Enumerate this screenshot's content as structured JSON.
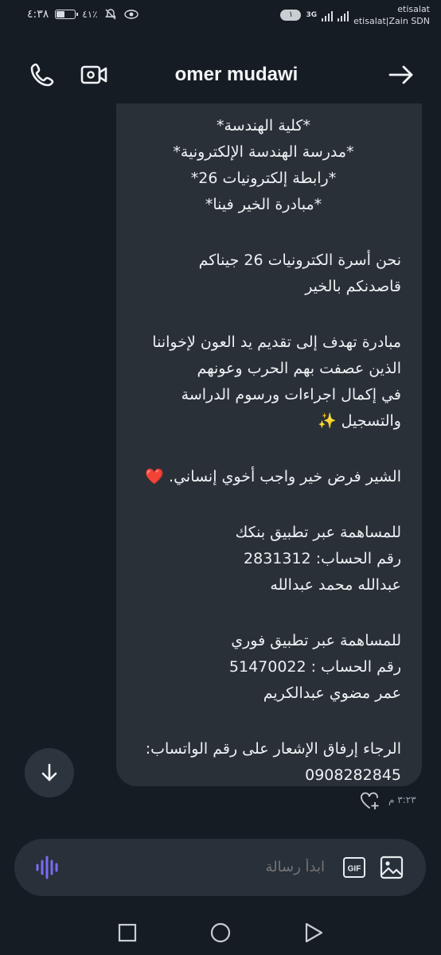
{
  "status": {
    "time": "٤:٣٨",
    "battery_pct": "٤١٪",
    "sim_slot": "١",
    "network_type": "3G",
    "carrier_1": "etisalat",
    "carrier_2": "etisalat|Zain SDN"
  },
  "header": {
    "contact_name": "omer mudawi",
    "icons": [
      "phone-icon",
      "video-call-icon",
      "arrow-right-icon"
    ]
  },
  "message": {
    "lines": [
      "*كلية الهندسة*",
      "*مدرسة الهندسة الإلكترونية*",
      "*رابطة إلكترونيات 26*",
      "*مبادرة الخير فينا*",
      "نحن أسرة الكترونيات 26 جيناكم",
      "قاصدنكم بالخير",
      "مبادرة تهدف إلى تقديم يد العون لإخواننا",
      "الذين عصفت بهم الحرب وعونهم",
      "في إكمال اجراءات ورسوم الدراسة",
      "والتسجيل",
      "الشير فرض خير واجب أخوي إنساني.",
      "للمساهمة عبر تطبيق بنكك",
      "رقم الحساب: 2831312",
      "عبدالله محمد عبدالله",
      "للمساهمة عبر تطبيق فوري",
      "رقم الحساب : 51470022",
      "عمر مضوي عبدالكريم",
      "الرجاء إرفاق الإشعار على رقم الواتساب:",
      "0908282845"
    ],
    "sparkle_emoji": "✨",
    "heart_emoji": "❤️",
    "timestamp": "٣:٢٣ م"
  },
  "composer": {
    "placeholder": "ابدأ رسالة",
    "gif_label": "GIF"
  },
  "colors": {
    "background": "#151c24",
    "bubble": "#293038",
    "composer": "#28303a",
    "accent_mic": "#7b6cf0"
  }
}
